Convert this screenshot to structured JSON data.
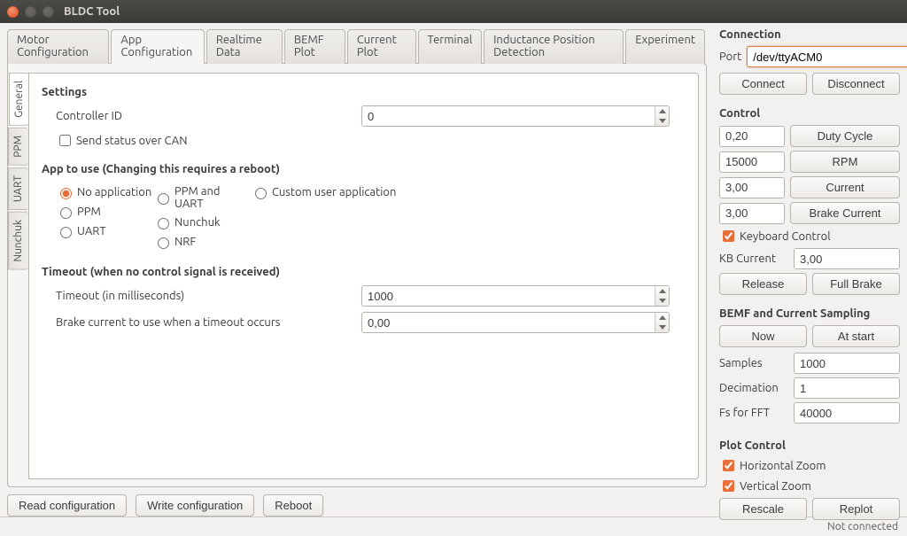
{
  "window": {
    "title": "BLDC Tool"
  },
  "outerTabs": [
    "Motor Configuration",
    "App Configuration",
    "Realtime Data",
    "BEMF Plot",
    "Current Plot",
    "Terminal",
    "Inductance Position Detection",
    "Experiment"
  ],
  "outerActive": 1,
  "sideTabs": [
    "General",
    "PPM",
    "UART",
    "Nunchuk"
  ],
  "sideActive": 0,
  "settings": {
    "title": "Settings",
    "controllerIdLabel": "Controller ID",
    "controllerId": "0",
    "sendStatusLabel": "Send status over CAN",
    "sendStatus": false
  },
  "appToUse": {
    "title": "App to use (Changing this requires a reboot)",
    "options": {
      "no_app": {
        "label": "No application",
        "checked": true
      },
      "ppm": {
        "label": "PPM",
        "checked": false
      },
      "uart": {
        "label": "UART",
        "checked": false
      },
      "ppm_uart": {
        "label": "PPM and UART",
        "checked": false
      },
      "nunchuk": {
        "label": "Nunchuk",
        "checked": false
      },
      "nrf": {
        "label": "NRF",
        "checked": false
      },
      "custom": {
        "label": "Custom user application",
        "checked": false
      }
    }
  },
  "timeout": {
    "title": "Timeout (when no control signal is received)",
    "msLabel": "Timeout (in milliseconds)",
    "ms": "1000",
    "brakeLabel": "Brake current to use when a timeout occurs",
    "brake": "0,00"
  },
  "bottom": {
    "read": "Read configuration",
    "write": "Write configuration",
    "reboot": "Reboot"
  },
  "connection": {
    "title": "Connection",
    "portLabel": "Port",
    "port": "/dev/ttyACM0",
    "connect": "Connect",
    "disconnect": "Disconnect"
  },
  "control": {
    "title": "Control",
    "duty": {
      "value": "0,20",
      "btn": "Duty Cycle"
    },
    "rpm": {
      "value": "15000",
      "btn": "RPM"
    },
    "cur": {
      "value": "3,00",
      "btn": "Current"
    },
    "brake": {
      "value": "3,00",
      "btn": "Brake Current"
    },
    "keyboardLabel": "Keyboard Control",
    "keyboard": true,
    "kbCurLabel": "KB Current",
    "kbCur": "3,00",
    "release": "Release",
    "fullBrake": "Full Brake"
  },
  "sampling": {
    "title": "BEMF and Current Sampling",
    "now": "Now",
    "atStart": "At start",
    "samplesLabel": "Samples",
    "samples": "1000",
    "decLabel": "Decimation",
    "dec": "1",
    "fsLabel": "Fs for FFT",
    "fs": "40000"
  },
  "plot": {
    "title": "Plot Control",
    "hzLabel": "Horizontal Zoom",
    "hz": true,
    "vzLabel": "Vertical Zoom",
    "vz": true,
    "rescale": "Rescale",
    "replot": "Replot"
  },
  "status": {
    "text": "Not connected"
  }
}
